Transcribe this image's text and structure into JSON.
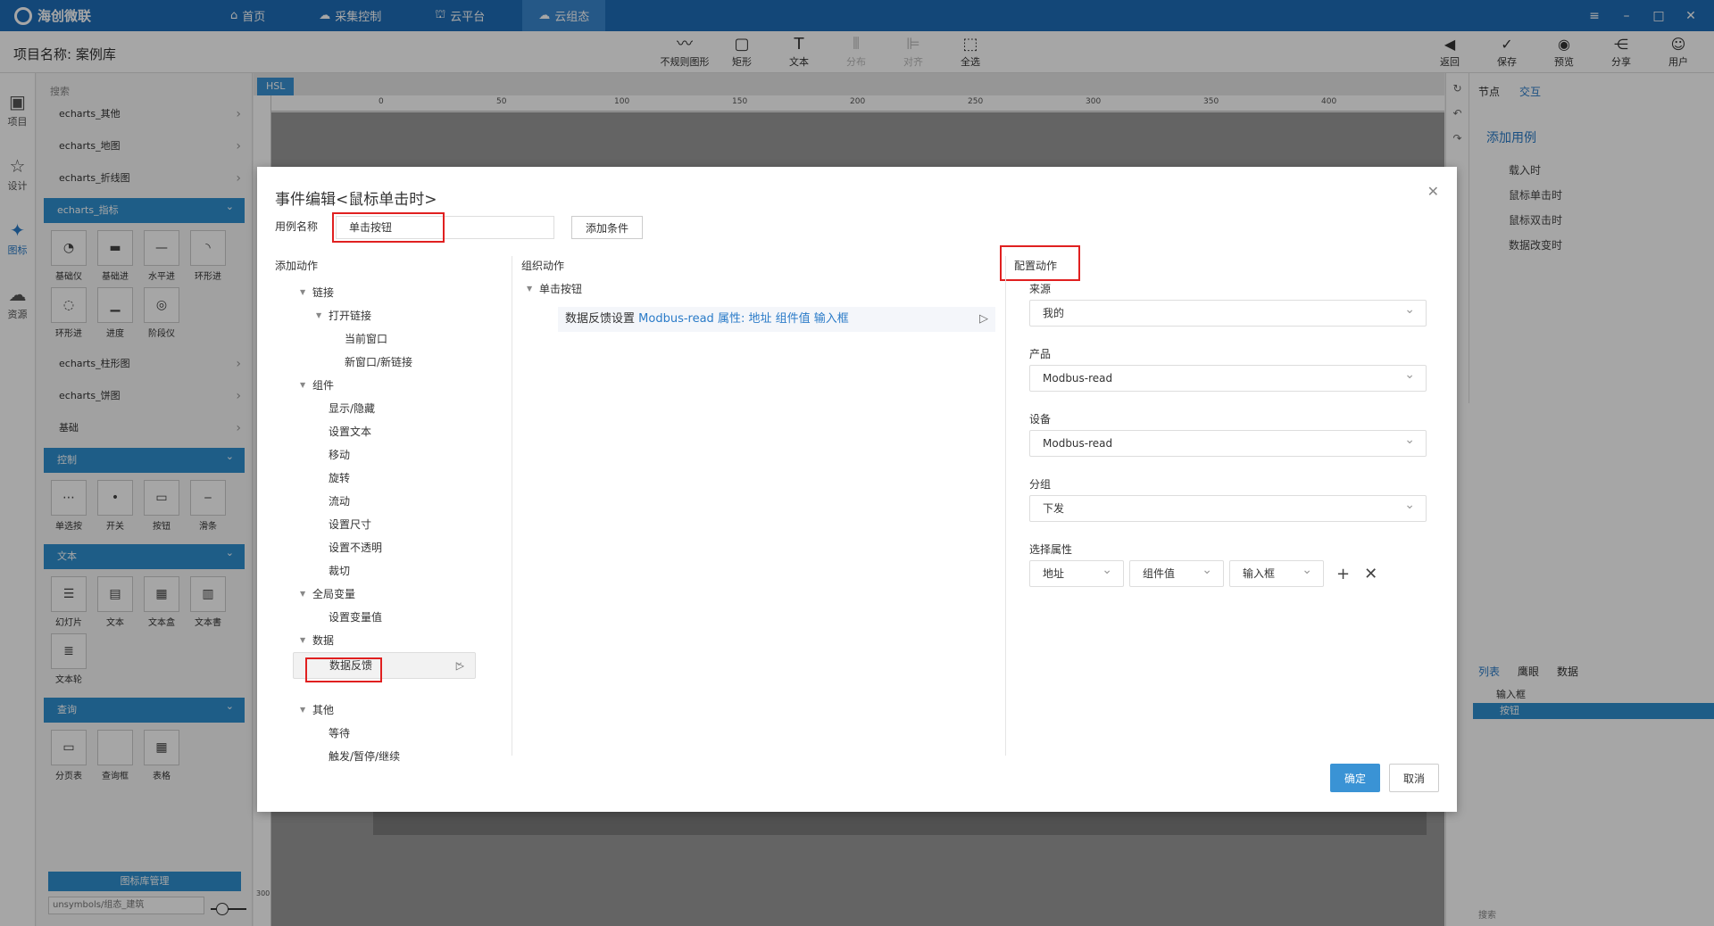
{
  "app": {
    "brand": "海创微联",
    "navs": [
      "首页",
      "采集控制",
      "云平台",
      "云组态"
    ],
    "active_nav": 3
  },
  "toolbar": {
    "project_label": "项目名称:",
    "project_name": "案例库",
    "tools": [
      "不规则图形",
      "矩形",
      "文本",
      "分布",
      "对齐",
      "全选"
    ],
    "right_tools": [
      "返回",
      "保存",
      "预览",
      "分享",
      "用户"
    ]
  },
  "rail": [
    "项目",
    "设计",
    "图标",
    "资源"
  ],
  "left_panel": {
    "search_label": "搜索",
    "rows_top": [
      "echarts_其他",
      "echarts_地图",
      "echarts_折线图"
    ],
    "cat_gauge": "echarts_指标",
    "gauge_items": [
      "基础仪",
      "基础进",
      "水平进",
      "环形进",
      "环形进",
      "进度",
      "阶段仪"
    ],
    "rows_mid": [
      "echarts_柱形图",
      "echarts_饼图",
      "基础"
    ],
    "cat_control": "控制",
    "control_items": [
      "单选按",
      "开关",
      "按钮",
      "滑条"
    ],
    "cat_text": "文本",
    "text_items": [
      "幻灯片",
      "文本",
      "文本盒",
      "文本書",
      "文本轮"
    ],
    "cat_query": "查询",
    "query_items": [
      "分页表",
      "查询框",
      "表格"
    ],
    "lib_manager": "图标库管理",
    "lib_path": "unsymbols/组态_建筑"
  },
  "canvas": {
    "tab": "HSL",
    "ruler_ticks": [
      "0",
      "50",
      "100",
      "150",
      "200",
      "250",
      "300",
      "350",
      "400"
    ],
    "ruler_left_tick": "300"
  },
  "right_panel": {
    "tabs": [
      "节点",
      "交互"
    ],
    "add_case": "添加用例",
    "events": [
      "载入时",
      "鼠标单击时",
      "鼠标双击时",
      "数据改变时"
    ],
    "bottom_tabs": [
      "列表",
      "鹰眼",
      "数据"
    ],
    "layers": [
      "输入框",
      "按钮"
    ],
    "search": "搜索"
  },
  "dialog": {
    "title": "事件编辑<鼠标单击时>",
    "case_label": "用例名称",
    "case_value": "单击按钮",
    "add_condition": "添加条件",
    "col_add": "添加动作",
    "col_org": "组织动作",
    "col_cfg": "配置动作",
    "tree": [
      {
        "label": "链接",
        "level": 0,
        "arrow": true
      },
      {
        "label": "打开链接",
        "level": 1,
        "arrow": true
      },
      {
        "label": "当前窗口",
        "level": 2
      },
      {
        "label": "新窗口/新链接",
        "level": 2
      },
      {
        "label": "组件",
        "level": 0,
        "arrow": true
      },
      {
        "label": "显示/隐藏",
        "level": 1
      },
      {
        "label": "设置文本",
        "level": 1
      },
      {
        "label": "移动",
        "level": 1
      },
      {
        "label": "旋转",
        "level": 1
      },
      {
        "label": "流动",
        "level": 1
      },
      {
        "label": "设置尺寸",
        "level": 1
      },
      {
        "label": "设置不透明",
        "level": 1
      },
      {
        "label": "裁切",
        "level": 1
      },
      {
        "label": "全局变量",
        "level": 0,
        "arrow": true
      },
      {
        "label": "设置变量值",
        "level": 1
      },
      {
        "label": "数据",
        "level": 0,
        "arrow": true
      },
      {
        "label": "数据反馈",
        "level": 1,
        "selected": true
      },
      {
        "label": "其他",
        "level": 0,
        "arrow": true
      },
      {
        "label": "等待",
        "level": 1
      },
      {
        "label": "触发/暂停/继续",
        "level": 1
      }
    ],
    "org_case": "单击按钮",
    "action_prefix": "数据反馈设置",
    "action_detail": "Modbus-read 属性:  地址 组件值 输入框",
    "source_label": "来源",
    "source_value": "我的",
    "product_label": "产品",
    "product_value": "Modbus-read",
    "device_label": "设备",
    "device_value": "Modbus-read",
    "group_label": "分组",
    "group_value": "下发",
    "attr_label": "选择属性",
    "attr_values": [
      "地址",
      "组件值",
      "输入框"
    ],
    "ok": "确定",
    "cancel": "取消"
  }
}
